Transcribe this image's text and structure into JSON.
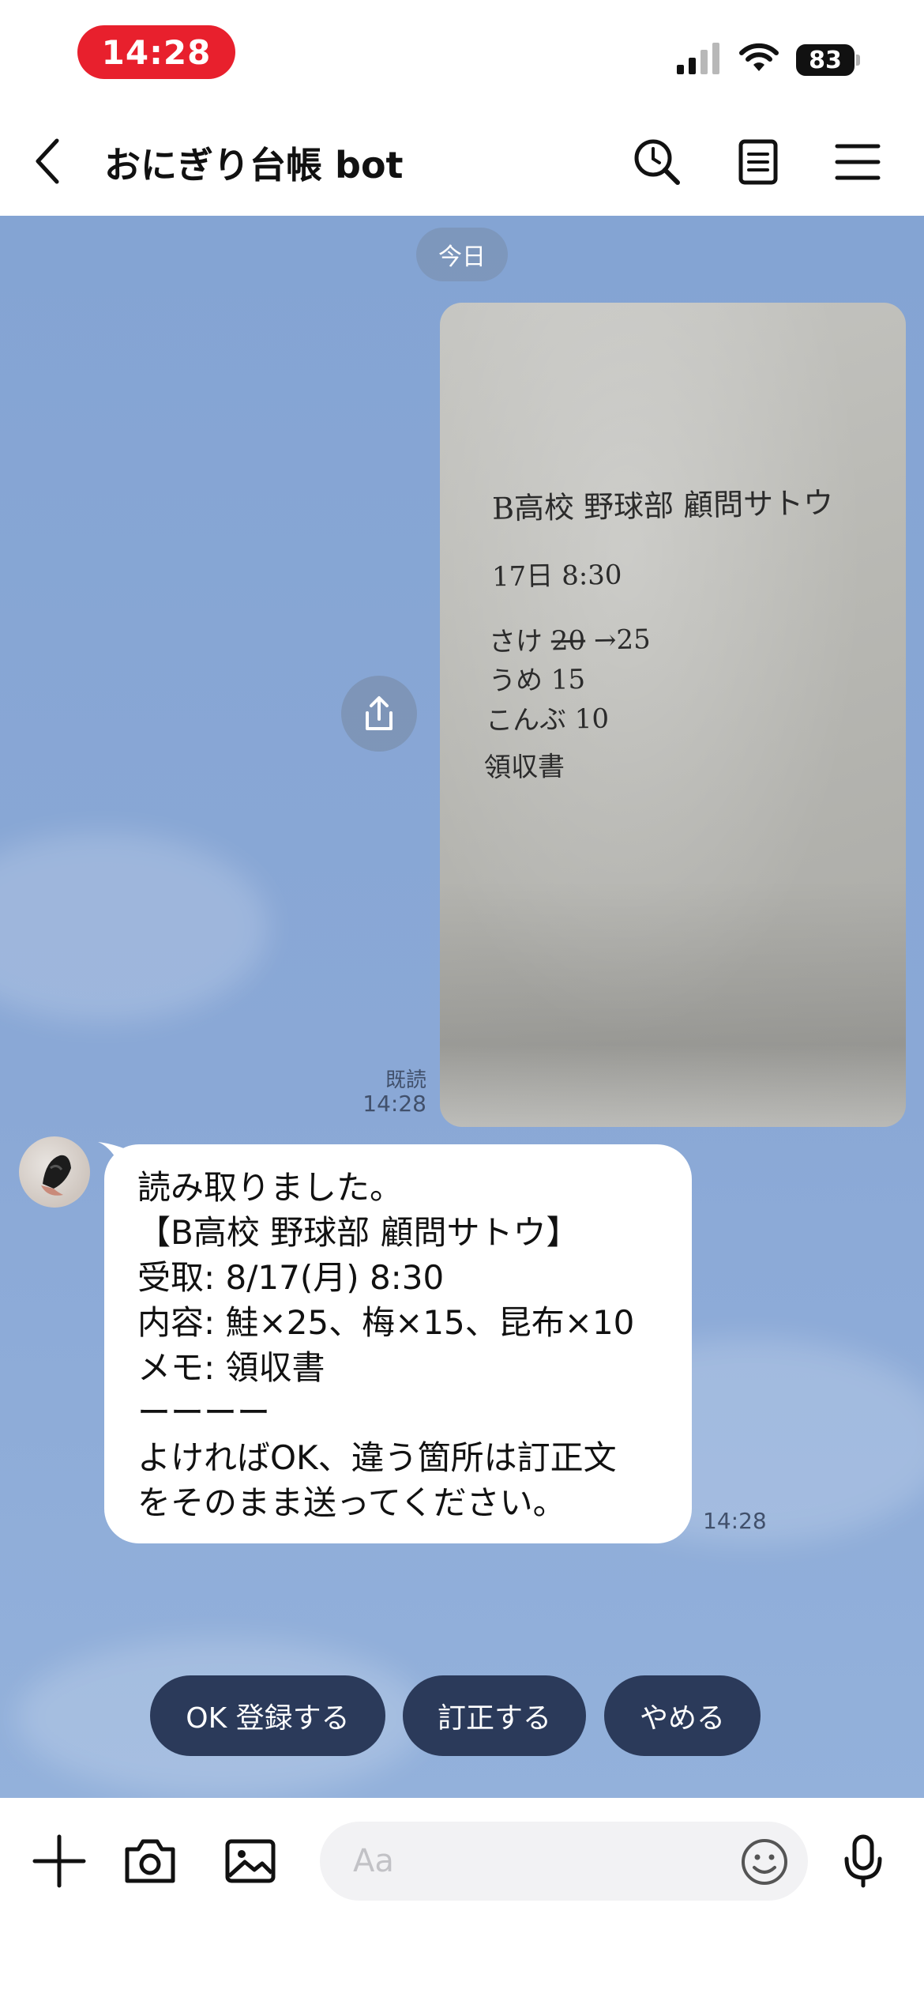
{
  "status_bar": {
    "time": "14:28",
    "battery": "83",
    "signal_icon": "cellular-signal-icon",
    "wifi_icon": "wifi-icon"
  },
  "header": {
    "title": "おにぎり台帳 bot",
    "back_icon": "chevron-left-icon",
    "search_icon": "search-icon",
    "notes_icon": "notes-icon",
    "menu_icon": "menu-icon"
  },
  "chat": {
    "date_label": "今日",
    "image_message": {
      "handwritten_lines": [
        "B高校 野球部 顧問サトウ",
        "17日 8:30",
        "さけ ",
        "20",
        " →25",
        "うめ 15",
        "こんぶ 10",
        "領収書"
      ],
      "read_label": "既読",
      "time": "14:28"
    },
    "bot_message": {
      "lines": [
        "読み取りました。",
        "【B高校 野球部 顧問サトウ】",
        "受取: 8/17(月) 8:30",
        "内容: 鮭×25、梅×15、昆布×10",
        "メモ: 領収書",
        "ーーーー",
        "よければOK、違う箇所は訂正文",
        "をそのまま送ってください。"
      ],
      "time": "14:28"
    },
    "quick_replies": [
      "OK 登録する",
      "訂正する",
      "やめる"
    ]
  },
  "input_bar": {
    "placeholder": "Aa",
    "icons": [
      "plus-icon",
      "camera-icon",
      "image-icon",
      "emoji-icon",
      "microphone-icon"
    ]
  },
  "colors": {
    "status_time_pill": "#e8202d",
    "chat_background": "#87a6d5",
    "quick_reply_bg": "#2b3a5a",
    "bubble_bg": "#ffffff"
  }
}
